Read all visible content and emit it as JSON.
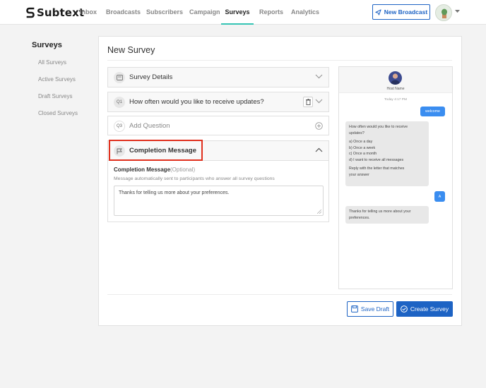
{
  "brand": {
    "name": "Subtext"
  },
  "nav": {
    "items": [
      {
        "label": "Inbox"
      },
      {
        "label": "Broadcasts"
      },
      {
        "label": "Subscribers"
      },
      {
        "label": "Campaign"
      },
      {
        "label": "Surveys",
        "active": true
      },
      {
        "label": "Reports"
      },
      {
        "label": "Analytics"
      }
    ],
    "new_broadcast_label": "New Broadcast",
    "accent_color": "#35c4b4"
  },
  "sidebar": {
    "title": "Surveys",
    "items": [
      {
        "label": "All Surveys"
      },
      {
        "label": "Active Surveys"
      },
      {
        "label": "Draft Surveys"
      },
      {
        "label": "Closed Surveys"
      }
    ]
  },
  "survey": {
    "title": "New Survey",
    "sections": [
      {
        "label": "Survey Details",
        "icon": "survey-details-icon"
      },
      {
        "tag": "Q1",
        "label": "How often would you like to receive updates?"
      },
      {
        "tag": "Q3",
        "label": "Add Question"
      },
      {
        "label": "Completion Message",
        "icon": "flag-icon",
        "expanded": true
      }
    ],
    "completion": {
      "label": "Completion Message",
      "optional": "(Optional)",
      "help": "Message automatically sent to participants who answer all survey questions",
      "value": "Thanks for telling us more about your preferences."
    }
  },
  "preview": {
    "host_name": "Host Name",
    "timestamp": "Today 4:17 PM",
    "messages": [
      {
        "dir": "out",
        "text": "welcome"
      },
      {
        "dir": "in",
        "lines": [
          "How often would you like to receive",
          "updates?",
          "",
          "a) Once a day",
          "b) Once a week",
          "c) Once a month",
          "d) I want to receive all messages",
          "",
          "Reply with the letter that matches",
          "your answer"
        ]
      },
      {
        "dir": "out",
        "text": "A"
      },
      {
        "dir": "in",
        "lines": [
          "Thanks for telling us more about your",
          "preferences."
        ]
      }
    ]
  },
  "actions": {
    "save_draft": "Save Draft",
    "create_survey": "Create Survey"
  },
  "colors": {
    "primary": "#1d63c4",
    "highlight": "#e0301e",
    "bubble_out": "#3a8df0"
  }
}
